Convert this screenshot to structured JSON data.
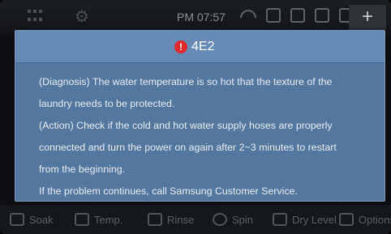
{
  "topbar": {
    "clock": "PM 07:57",
    "plus_label": "+",
    "icons": [
      "grid-icon",
      "gear-icon",
      "wifi-icon",
      "key-icon",
      "lock-icon",
      "bag-icon",
      "phone-icon"
    ]
  },
  "dialog": {
    "error_code": "4E2",
    "warn_glyph": "!",
    "lines": [
      "(Diagnosis) The water temperature is so hot that the texture of the",
      "laundry needs to be protected.",
      "(Action) Check if the cold and hot water supply hoses are properly",
      "connected and turn the power on again after 2~3 minutes to restart",
      "from the beginning.",
      "If the problem continues, call Samsung Customer Service."
    ]
  },
  "bottombar": {
    "soak": "Soak",
    "temp": "Temp.",
    "rinse": "Rinse",
    "spin": "Spin",
    "dry_level": "Dry Level",
    "options": "Options"
  },
  "colors": {
    "dialog_bg": "#54779f",
    "dialog_header": "#648ab5",
    "warning": "#e0282d"
  }
}
